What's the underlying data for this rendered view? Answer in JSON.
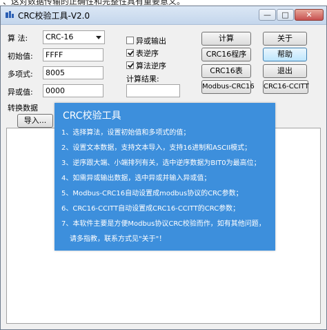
{
  "top_text": "、这对数据传输的正确性和完整性具有重要意义。",
  "window": {
    "title": "CRC校验工具-V2.0",
    "controls": {
      "minimize": "—",
      "maximize": "□",
      "close": "✕"
    }
  },
  "form": {
    "algorithm_label": "算  法:",
    "algorithm_value": "CRC-16",
    "init_label": "初始值:",
    "init_value": "FFFF",
    "poly_label": "多项式:",
    "poly_value": "8005",
    "xor_label": "异或值:",
    "xor_value": "0000"
  },
  "options": {
    "xor_output": {
      "label": "异或输出",
      "checked": false
    },
    "table_reverse": {
      "label": "表逆序",
      "checked": true
    },
    "algo_reverse": {
      "label": "算法逆序",
      "checked": true
    },
    "result_label": "计算结果:",
    "result_value": ""
  },
  "buttons": {
    "calc": "计算",
    "about": "关于",
    "crc16_program": "CRC16程序",
    "help": "帮助",
    "crc16_table": "CRC16表",
    "exit": "退出",
    "modbus": "Modbus-CRC16",
    "ccitt": "CRC16-CCITT",
    "import": "导入..."
  },
  "data_section_label": "转换数据",
  "help_popup": {
    "title": "CRC校验工具",
    "lines": [
      "1、选择算法，设置初始值和多项式的值；",
      "2、设置文本数据，支持文本导入，支持16进制和ASCII模式；",
      "3、逆序跟大端、小端排列有关，选中逆序数据为BIT0为最高位；",
      "4、如需异或输出数据，选中异或并输入异或值；",
      "5、Modbus-CRC16自动设置成modbus协议的CRC参数；",
      "6、CRC16-CCITT自动设置成CRC16-CCITT的CRC参数；",
      "7、本软件主要是方便Modbus协议CRC校验而作，如有其他问题，",
      "请多指教，联系方式见\"关于\"！"
    ]
  },
  "colors": {
    "popup_bg": "#3d8fdc",
    "title_bar": "#c4d6ec",
    "window_bg": "#f0f0f0"
  }
}
